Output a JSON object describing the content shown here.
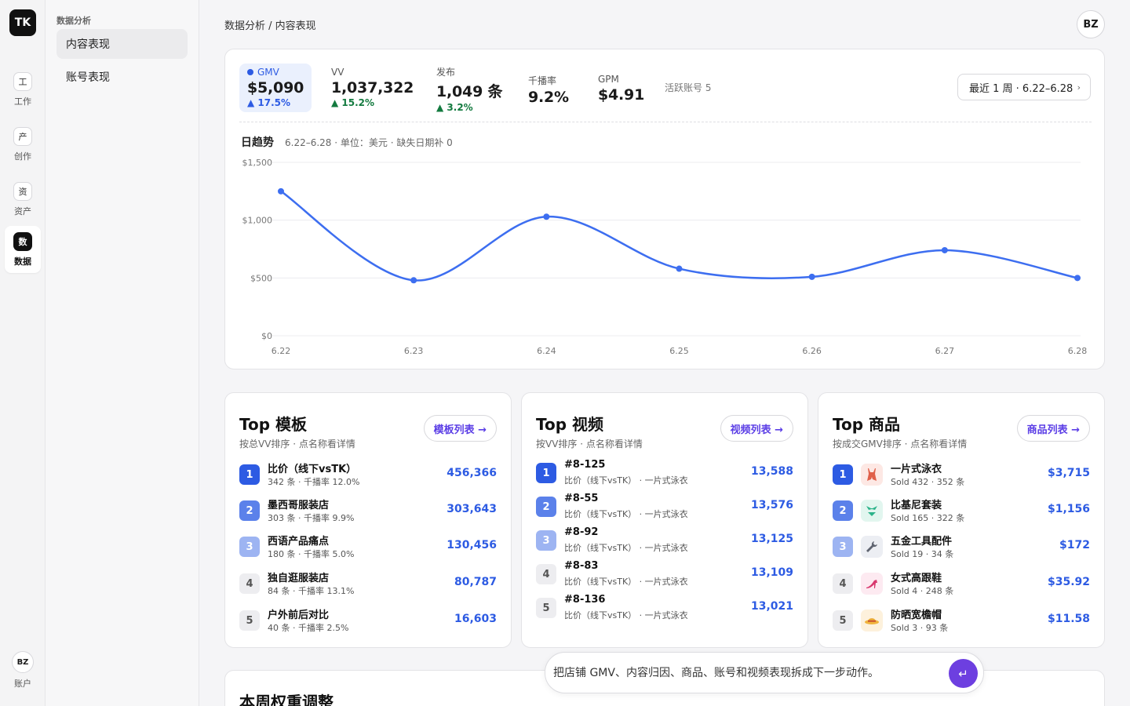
{
  "rail": {
    "logo": "TK",
    "items": [
      {
        "icon": "工",
        "label": "工作"
      },
      {
        "icon": "产",
        "label": "创作"
      },
      {
        "icon": "资",
        "label": "资产"
      },
      {
        "icon": "数",
        "label": "数据"
      }
    ],
    "account_avatar": "BZ",
    "account_label": "账户"
  },
  "sidebar": {
    "section": "数据分析",
    "items": [
      {
        "label": "内容表现"
      },
      {
        "label": "账号表现"
      }
    ]
  },
  "header": {
    "breadcrumb": "数据分析 / 内容表现",
    "avatar": "BZ"
  },
  "kpis": [
    {
      "label": "GMV",
      "value": "$5,090",
      "delta": "▲ 17.5%"
    },
    {
      "label": "VV",
      "value": "1,037,322",
      "delta": "▲ 15.2%"
    },
    {
      "label": "发布",
      "value": "1,049 条",
      "delta": "▲ 3.2%"
    },
    {
      "label": "千播率",
      "value": "9.2%"
    },
    {
      "label": "GPM",
      "value": "$4.91"
    }
  ],
  "active_accounts": "活跃账号 5",
  "range": {
    "label": "最近 1 周 · 6.22–6.28",
    "chevron": "›"
  },
  "trend": {
    "title": "日趋势",
    "subtitle": "6.22–6.28 · 单位：美元 · 缺失日期补 0"
  },
  "chart_data": {
    "type": "line",
    "title": "日趋势",
    "x": [
      "6.22",
      "6.23",
      "6.24",
      "6.25",
      "6.26",
      "6.27",
      "6.28"
    ],
    "series": [
      {
        "name": "GMV",
        "values": [
          1250,
          480,
          1030,
          580,
          510,
          740,
          500
        ]
      }
    ],
    "ylim": [
      0,
      1500
    ],
    "yticks": [
      "$0",
      "$500",
      "$1,000",
      "$1,500"
    ],
    "ytick_values": [
      0,
      500,
      1000,
      1500
    ],
    "grid": true,
    "color": "#3d6ef0"
  },
  "top_templates": {
    "title": "Top 模板",
    "subtitle": "按总VV排序 · 点名称看详情",
    "button": "模板列表 →",
    "rows": [
      {
        "rank": "1",
        "name": "比价（线下vsTK）",
        "meta": "342 条 · 千播率 12.0%",
        "value": "456,366"
      },
      {
        "rank": "2",
        "name": "墨西哥服装店",
        "meta": "303 条 · 千播率 9.9%",
        "value": "303,643"
      },
      {
        "rank": "3",
        "name": "西语产品痛点",
        "meta": "180 条 · 千播率 5.0%",
        "value": "130,456"
      },
      {
        "rank": "4",
        "name": "独自逛服装店",
        "meta": "84 条 · 千播率 13.1%",
        "value": "80,787"
      },
      {
        "rank": "5",
        "name": "户外前后对比",
        "meta": "40 条 · 千播率 2.5%",
        "value": "16,603"
      }
    ]
  },
  "top_videos": {
    "title": "Top 视频",
    "subtitle": "按VV排序 · 点名称看详情",
    "button": "视频列表 →",
    "rows": [
      {
        "rank": "1",
        "name": "#8-125",
        "meta": "比价（线下vsTK） · 一片式泳衣",
        "value": "13,588"
      },
      {
        "rank": "2",
        "name": "#8-55",
        "meta": "比价（线下vsTK） · 一片式泳衣",
        "value": "13,576"
      },
      {
        "rank": "3",
        "name": "#8-92",
        "meta": "比价（线下vsTK） · 一片式泳衣",
        "value": "13,125"
      },
      {
        "rank": "4",
        "name": "#8-83",
        "meta": "比价（线下vsTK） · 一片式泳衣",
        "value": "13,109"
      },
      {
        "rank": "5",
        "name": "#8-136",
        "meta": "比价（线下vsTK） · 一片式泳衣",
        "value": "13,021"
      }
    ]
  },
  "top_products": {
    "title": "Top 商品",
    "subtitle": "按成交GMV排序 · 点名称看详情",
    "button": "商品列表 →",
    "rows": [
      {
        "rank": "1",
        "name": "一片式泳衣",
        "meta": "Sold 432 · 352 条",
        "value": "$3,715",
        "icon": "swimsuit-icon",
        "bg": "#fde8e4"
      },
      {
        "rank": "2",
        "name": "比基尼套装",
        "meta": "Sold 165 · 322 条",
        "value": "$1,156",
        "icon": "bikini-icon",
        "bg": "#e2f6ef"
      },
      {
        "rank": "3",
        "name": "五金工具配件",
        "meta": "Sold 19 · 34 条",
        "value": "$172",
        "icon": "wrench-icon",
        "bg": "#eceef3"
      },
      {
        "rank": "4",
        "name": "女式高跟鞋",
        "meta": "Sold 4 · 248 条",
        "value": "$35.92",
        "icon": "high-heel-icon",
        "bg": "#fdeaf1"
      },
      {
        "rank": "5",
        "name": "防晒宽檐帽",
        "meta": "Sold 3 · 93 条",
        "value": "$11.58",
        "icon": "sun-hat-icon",
        "bg": "#fdf1dc"
      }
    ]
  },
  "weight_section": {
    "title": "本周权重调整"
  },
  "ask": {
    "placeholder": "把店铺 GMV、内容归因、商品、账号和视频表现拆成下一步动作。",
    "send_icon": "↵"
  }
}
